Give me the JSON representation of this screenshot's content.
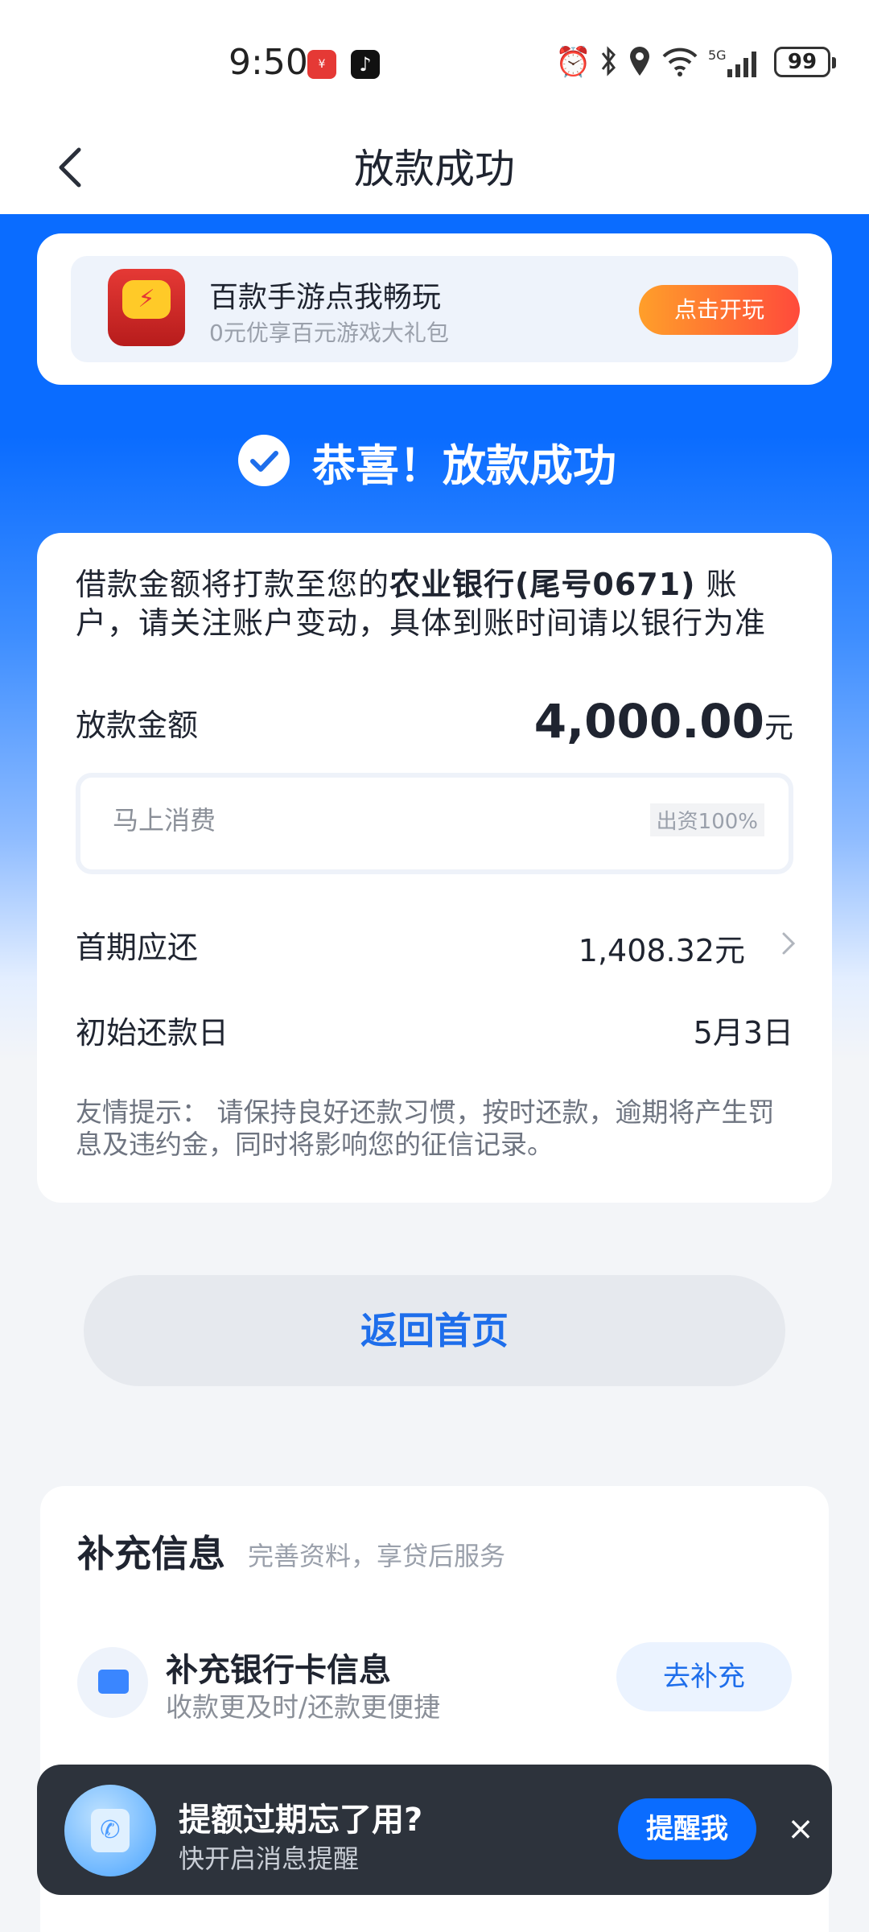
{
  "status_bar": {
    "time": "9:50",
    "battery": "99",
    "icons": [
      "alarm-icon",
      "bluetooth-icon",
      "location-icon",
      "wifi-icon",
      "signal-5g-icon"
    ]
  },
  "header": {
    "title": "放款成功"
  },
  "ad": {
    "title": "百款手游点我畅玩",
    "subtitle": "0元优享百元游戏大礼包",
    "button": "点击开玩"
  },
  "success": {
    "text": "恭喜！放款成功"
  },
  "loan": {
    "notice_prefix": "借款金额将打款至您的",
    "bank": "农业银行(尾号0671)",
    "notice_suffix": "账户，请关注账户变动，具体到账时间请以银行为准",
    "amount_label": "放款金额",
    "amount": "4,000.00",
    "amount_unit": "元",
    "lender_name": "马上消费",
    "lender_share": "出资100%",
    "first_payment_label": "首期应还",
    "first_payment_value": "1,408.32元",
    "start_date_label": "初始还款日",
    "start_date_value": "5月3日",
    "tip": "友情提示： 请保持良好还款习惯，按时还款，逾期将产生罚息及违约金，同时将影响您的征信记录。"
  },
  "actions": {
    "return_home": "返回首页"
  },
  "supplement": {
    "title": "补充信息",
    "subtitle": "完善资料，享贷后服务",
    "item_title": "补充银行卡信息",
    "item_subtitle": "收款更及时/还款更便捷",
    "item_button": "去补充"
  },
  "reminder": {
    "title": "提额过期忘了用?",
    "subtitle": "快开启消息提醒",
    "button": "提醒我",
    "close": "×"
  },
  "colors": {
    "brand_blue": "#0a6cff",
    "ad_button_start": "#ff9f2a",
    "ad_button_end": "#ff4a3b",
    "reminder_bg": "#2d333c"
  }
}
